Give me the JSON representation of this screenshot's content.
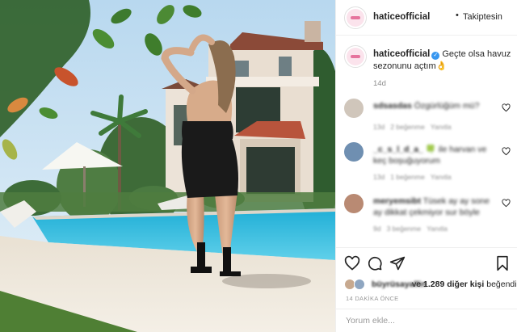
{
  "post": {
    "username": "haticeofficial",
    "verified_icon": "verified-badge-icon",
    "dot": "•",
    "follow_label": "Takiptesin",
    "caption_username": "haticeofficial",
    "caption_text": "Geçte olsa havuz sezonunu açtım👌",
    "time_ago": "14d",
    "comments": [
      {
        "author": "sdsasdas",
        "text": "Özgürlüğüm mü?",
        "meta_likes": "13d",
        "meta_reply": "2 beğenme",
        "meta_action": "Yanıtla",
        "avatar_color": "#c9b9a9"
      },
      {
        "author": "_c_s_l_d_a_",
        "text": "🍀 ile harvan ve keç boşuğuyorum",
        "meta_likes": "13d",
        "meta_reply": "1 beğenme",
        "meta_action": "Yanıtla",
        "avatar_color": "#7a96b5"
      },
      {
        "author": "meryemsibt",
        "text": "Tüsek ay ay sone ay dikkat çekmiyor sur böyle",
        "meta_likes": "9d",
        "meta_reply": "3 beğenme",
        "meta_action": "Yanıtla",
        "avatar_color": "#b88a72"
      }
    ],
    "likes_blurred_name": "büyrüsayallin",
    "likes_and": "ve",
    "likes_count_text": "1.289 diğer kişi",
    "likes_suffix": "beğendi",
    "timestamp": "14 DAKİKA ÖNCE",
    "add_comment_placeholder": "Yorum ekle...",
    "icons": [
      "heart-icon",
      "comment-icon",
      "share-icon",
      "bookmark-icon"
    ],
    "colors": {
      "verified": "#3897f0",
      "text": "#262626",
      "muted": "#8e8e8e",
      "pool": "#23b6d9"
    }
  }
}
